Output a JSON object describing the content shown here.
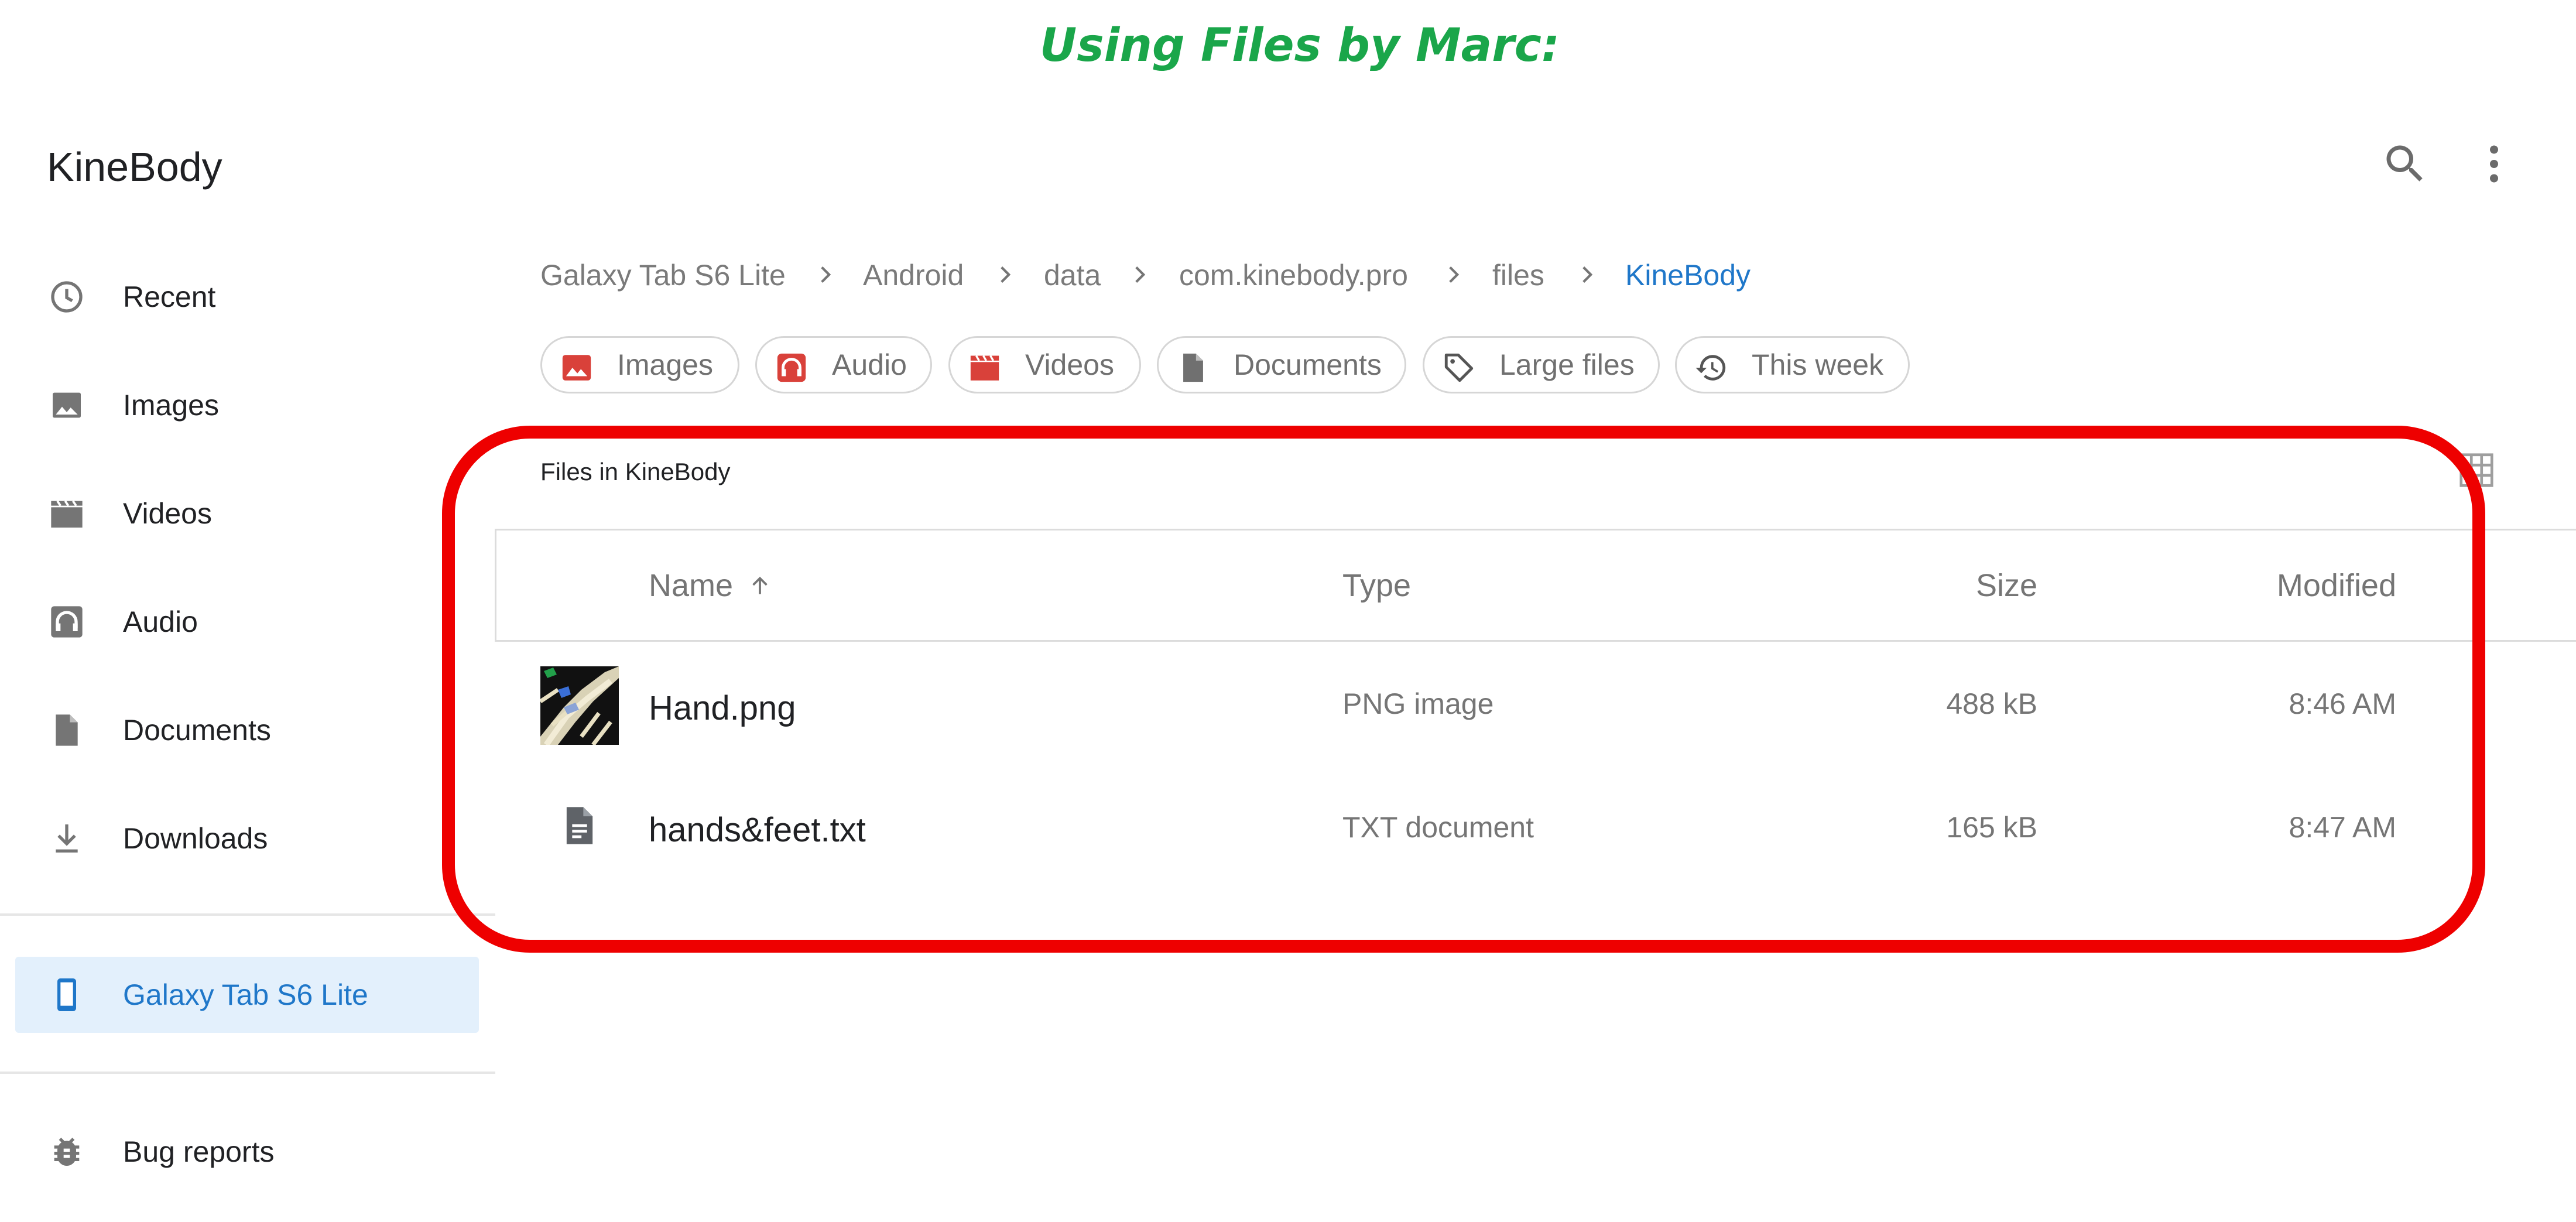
{
  "caption": "Using Files by Marc:",
  "app": {
    "title": "KineBody",
    "search_icon": "search-icon",
    "menu_icon": "more-vert-icon"
  },
  "sidebar": {
    "items": [
      {
        "label": "Recent",
        "icon": "clock-icon"
      },
      {
        "label": "Images",
        "icon": "image-icon"
      },
      {
        "label": "Videos",
        "icon": "video-icon"
      },
      {
        "label": "Audio",
        "icon": "headphones-icon"
      },
      {
        "label": "Documents",
        "icon": "document-icon"
      },
      {
        "label": "Downloads",
        "icon": "download-icon"
      },
      {
        "label": "Galaxy Tab S6 Lite",
        "icon": "tablet-icon",
        "active": true
      },
      {
        "label": "Bug reports",
        "icon": "bug-icon"
      }
    ]
  },
  "breadcrumb": [
    "Galaxy Tab S6 Lite",
    "Android",
    "data",
    "com.kinebody.pro",
    "files",
    "KineBody"
  ],
  "chips": [
    {
      "label": "Images",
      "icon": "image-icon"
    },
    {
      "label": "Audio",
      "icon": "headphones-icon"
    },
    {
      "label": "Videos",
      "icon": "video-icon"
    },
    {
      "label": "Documents",
      "icon": "document-icon"
    },
    {
      "label": "Large files",
      "icon": "tag-icon"
    },
    {
      "label": "This week",
      "icon": "history-icon"
    }
  ],
  "files_heading": "Files in KineBody",
  "table": {
    "columns": {
      "name": "Name",
      "type": "Type",
      "size": "Size",
      "modified": "Modified"
    },
    "sort": {
      "column": "Name",
      "direction": "ascending"
    },
    "rows": [
      {
        "name": "Hand.png",
        "type": "PNG image",
        "size": "488 kB",
        "modified": "8:46 AM",
        "icon": "image-thumbnail"
      },
      {
        "name": "hands&feet.txt",
        "type": "TXT document",
        "size": "165 kB",
        "modified": "8:47 AM",
        "icon": "text-file-icon"
      }
    ]
  },
  "colors": {
    "caption": "#1aa64a",
    "accent": "#1f77c9",
    "active_bg": "#e3f0fc",
    "highlight": "#ee0000",
    "chip_red": "#d9413a"
  }
}
